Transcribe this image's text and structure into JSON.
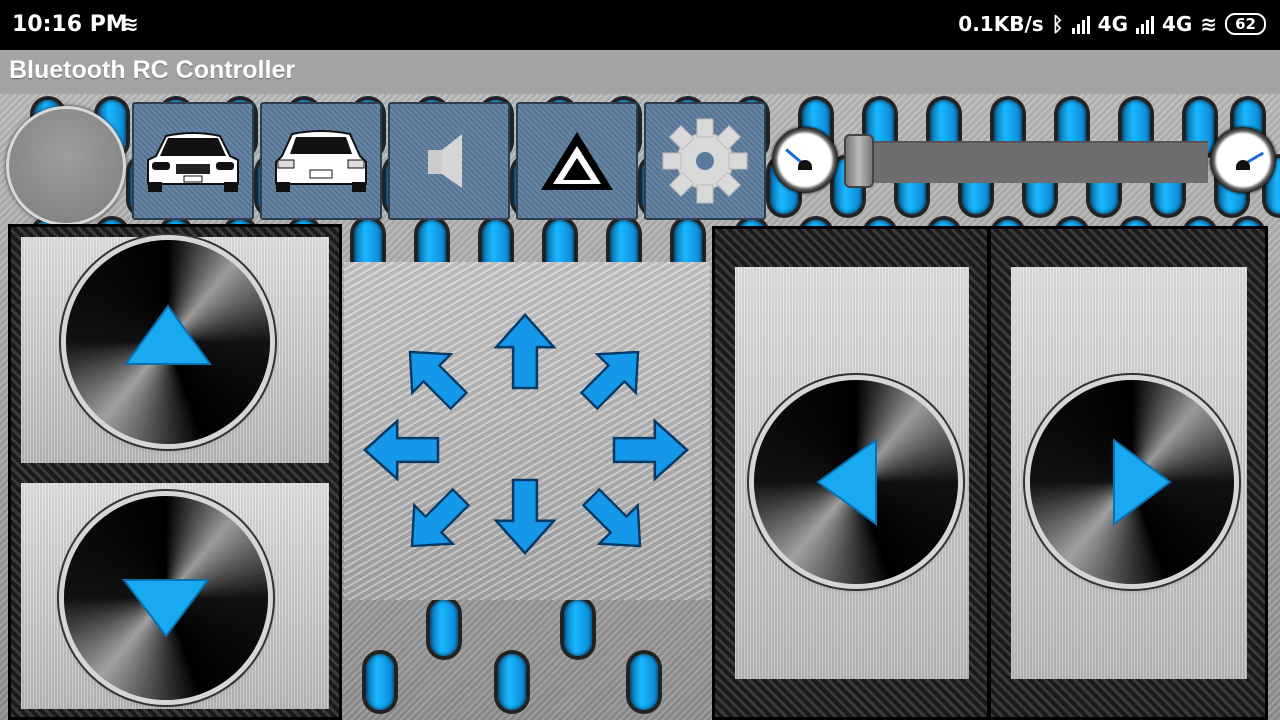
{
  "status_bar": {
    "time": "10:16 PM",
    "net_speed": "0.1KB/s",
    "sim1": "4G",
    "sim2": "4G",
    "battery": "62"
  },
  "app_bar": {
    "title": "Bluetooth RC Controller"
  },
  "toolbar": {
    "buttons": [
      {
        "name": "front-lights-button",
        "icon": "car-front-icon"
      },
      {
        "name": "back-lights-button",
        "icon": "car-rear-icon"
      },
      {
        "name": "horn-button",
        "icon": "speaker-icon"
      },
      {
        "name": "extra-button",
        "icon": "warning-triangle-icon"
      },
      {
        "name": "settings-button",
        "icon": "gear-icon"
      }
    ],
    "speed_slider": {
      "value": 0
    }
  },
  "colors": {
    "accent_blue": "#19a9f0",
    "toolbar_button": "#5c7c9e",
    "app_bar": "#a4a4a4"
  },
  "controls": [
    "forward",
    "backward",
    "left",
    "right",
    "forward-left",
    "forward-right",
    "back-left",
    "back-right"
  ]
}
